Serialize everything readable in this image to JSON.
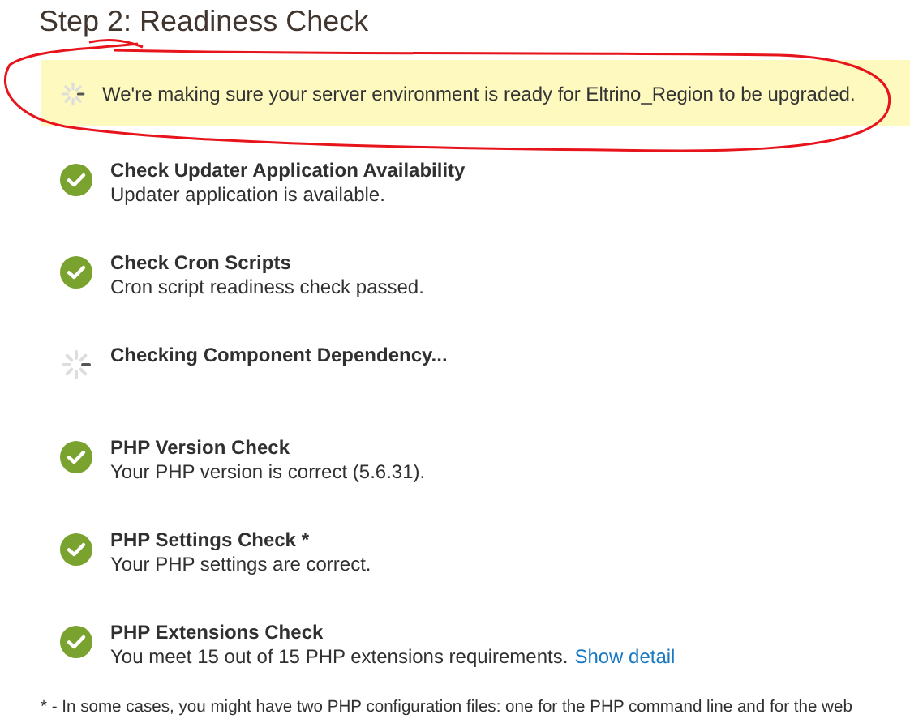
{
  "title": "Step 2: Readiness Check",
  "banner": {
    "text": "We're making sure your server environment is ready for Eltrino_Region to be upgraded."
  },
  "checks": [
    {
      "kind": "done",
      "title": "Check Updater Application Availability",
      "description": "Updater application is available."
    },
    {
      "kind": "done",
      "title": "Check Cron Scripts",
      "description": "Cron script readiness check passed."
    },
    {
      "kind": "pending",
      "title": "Checking Component Dependency..."
    },
    {
      "kind": "done",
      "title": "PHP Version Check",
      "description": "Your PHP version is correct (5.6.31)."
    },
    {
      "kind": "done",
      "title": "PHP Settings Check *",
      "description": "Your PHP settings are correct."
    },
    {
      "kind": "done",
      "title": "PHP Extensions Check",
      "description": "You meet 15 out of 15 PHP extensions requirements.",
      "link": "Show detail"
    }
  ],
  "footnote": "* - In some cases, you might have two PHP configuration files: one for the PHP command line and for the web"
}
